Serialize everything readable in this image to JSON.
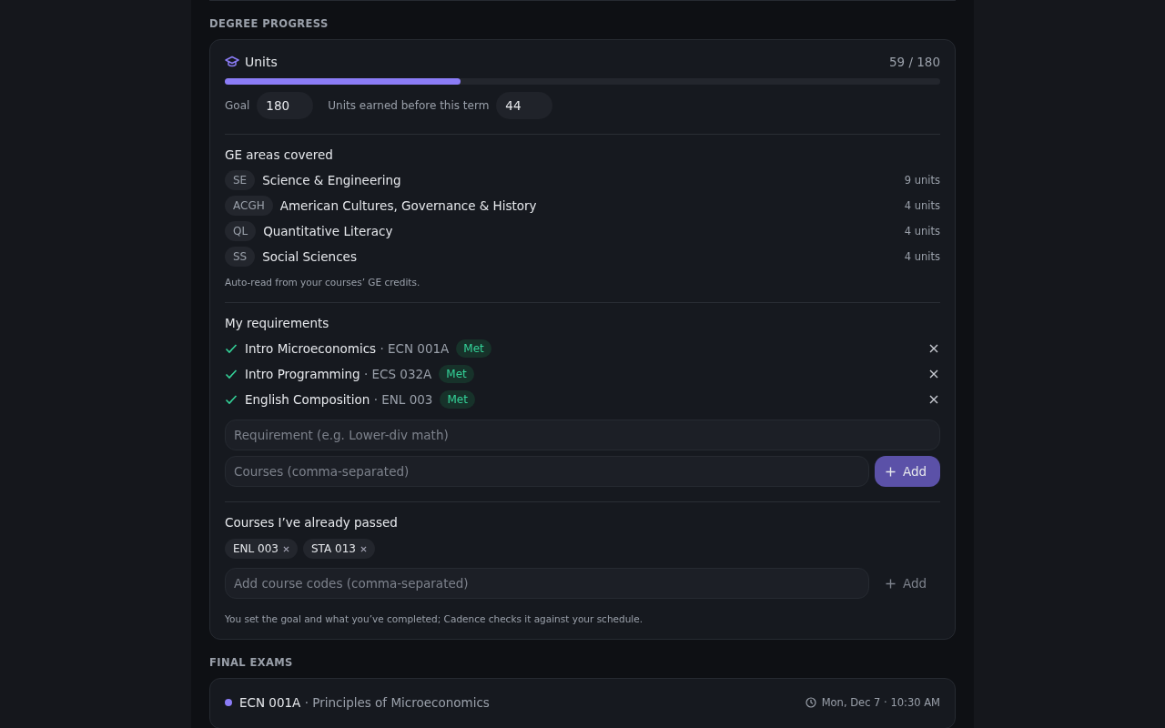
{
  "degree_progress": {
    "heading": "DEGREE PROGRESS",
    "units": {
      "title": "Units",
      "reading": "59 / 180",
      "level": 0.33,
      "goal_label": "Goal",
      "goal_value": "180",
      "earned_label": "Units earned before this term",
      "earned_value": "44"
    },
    "ge_areas": {
      "title": "GE areas covered",
      "items": [
        {
          "code": "SE",
          "name": "Science & Engineering",
          "units": "9 units"
        },
        {
          "code": "ACGH",
          "name": "American Cultures, Governance & History",
          "units": "4 units"
        },
        {
          "code": "QL",
          "name": "Quantitative Literacy",
          "units": "4 units"
        },
        {
          "code": "SS",
          "name": "Social Sciences",
          "units": "4 units"
        }
      ],
      "note": "Auto-read from your courses’ GE credits."
    },
    "requirements": {
      "title": "My requirements",
      "items": [
        {
          "name": "Intro Microeconomics",
          "course": "· ECN 001A",
          "met": true,
          "badge": "Met"
        },
        {
          "name": "Intro Programming",
          "course": "· ECS 032A",
          "met": true,
          "badge": "Met"
        },
        {
          "name": "English Composition",
          "course": "· ENL 003",
          "met": true,
          "badge": "Met"
        }
      ],
      "requirement_placeholder": "Requirement (e.g. Lower-div math)",
      "courses_placeholder": "Courses (comma-separated)",
      "add_button": "Add"
    },
    "passed": {
      "title": "Courses I’ve already passed",
      "chips": [
        "ENL 003",
        "STA 013"
      ],
      "placeholder": "Add course codes (comma-separated)",
      "add_button": "Add"
    },
    "footnote": "You set the goal and what you’ve completed; Cadence checks it against your schedule."
  },
  "final_exams": {
    "heading": "FINAL EXAMS",
    "items": [
      {
        "code": "ECN 001A",
        "title": "· Principles of Microeconomics",
        "time": "Mon, Dec 7 · 10:30 AM",
        "color": "#8b7cf6"
      }
    ]
  }
}
